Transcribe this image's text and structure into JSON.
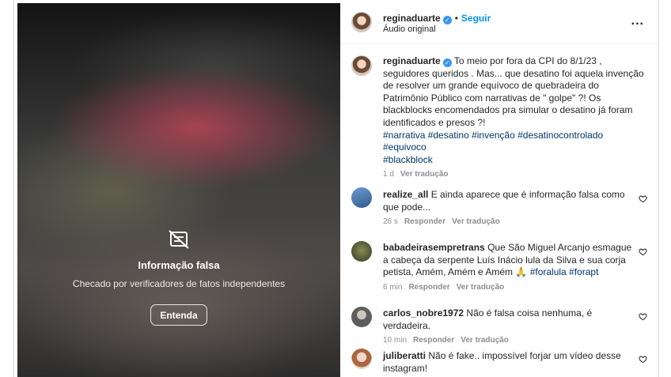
{
  "overlay": {
    "icon": "hidden-content-icon",
    "title": "Informação falsa",
    "subtitle": "Checado por verificadores de fatos independentes",
    "button_label": "Entenda"
  },
  "header": {
    "username": "reginaduarte",
    "separator": "•",
    "follow_label": "Seguir",
    "audio_label": "Áudio original",
    "more_icon": "more-options-icon",
    "more_label": "..."
  },
  "caption": {
    "username": "reginaduarte",
    "text": "To meio por fora da CPI do 8/1/23 , seguidores queridos . Mas... que desatino foi aquela invenção de resolver um grande equívoco de quebradeira do Patrimônio Público com narrativas de \" golpe\" ?! Os blackblocks encomendados pra simular o desatino já foram identificados e presos ?!",
    "hashtags_line1": "#narrativa #desatino #invenção #desatinocontrolado",
    "hashtags_line2": "#equivoco",
    "hashtags_line3": "#blackblock",
    "time": "1 d",
    "translate_label": "Ver tradução"
  },
  "comments": [
    {
      "username": "realize_all",
      "text": "E ainda aparece que é informação falsa como que pode...",
      "time": "26 s",
      "reply_label": "Responder",
      "translate_label": "Ver tradução"
    },
    {
      "username": "babadeirasempretrans",
      "text": "Que São Miguel Arcanjo esmague a cabeça da serpente Luís Inácio lula da Silva e sua corja petista, Amém, Amém e Amém 🙏",
      "tags": "#foralula #forapt",
      "time": "6 min",
      "reply_label": "Responder",
      "translate_label": "Ver tradução"
    },
    {
      "username": "carlos_nobre1972",
      "text": "Não é falsa coisa nenhuma, é verdadeira.",
      "time": "10 min",
      "reply_label": "Responder",
      "translate_label": "Ver tradução"
    },
    {
      "username": "juliberatti",
      "text": "Não é fake.. impossível forjar um vídeo desse instagram!"
    }
  ],
  "colors": {
    "link_blue": "#0095f6",
    "hashtag": "#00376b",
    "verified": "#3897f0",
    "muted": "#8e8e8e"
  }
}
